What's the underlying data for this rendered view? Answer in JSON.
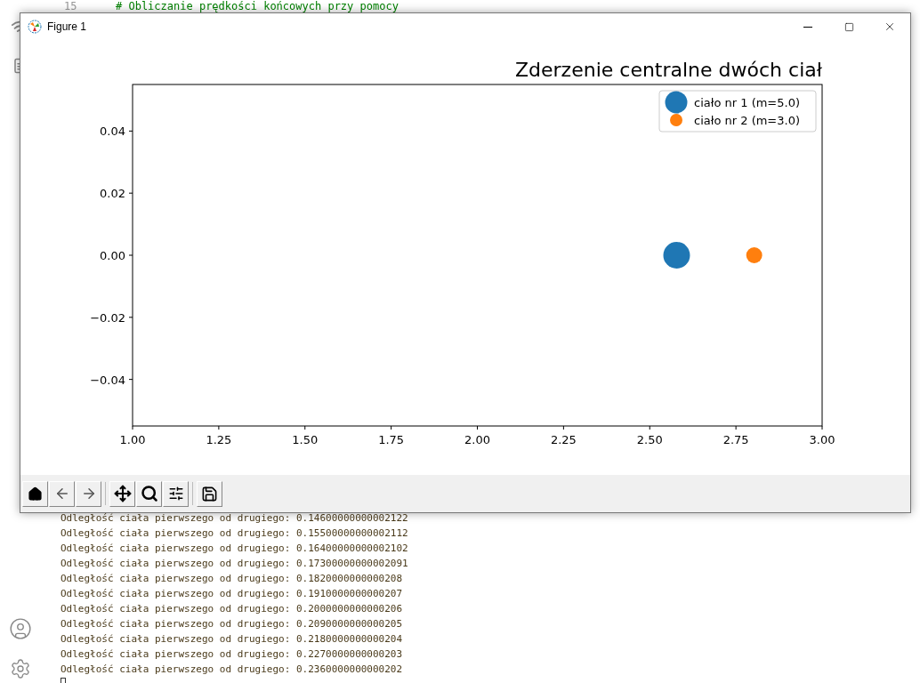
{
  "editor": {
    "line_number": "15",
    "code_line": "# Obliczanie prędkości końcowych przy pomocy"
  },
  "console": {
    "lines": [
      "Odległość ciała pierwszego od drugiego: 0.14600000000002122",
      "Odległość ciała pierwszego od drugiego: 0.15500000000002112",
      "Odległość ciała pierwszego od drugiego: 0.16400000000002102",
      "Odległość ciała pierwszego od drugiego: 0.17300000000002091",
      "Odległość ciała pierwszego od drugiego: 0.1820000000000208",
      "Odległość ciała pierwszego od drugiego: 0.1910000000000207",
      "Odległość ciała pierwszego od drugiego: 0.2000000000000206",
      "Odległość ciała pierwszego od drugiego: 0.2090000000000205",
      "Odległość ciała pierwszego od drugiego: 0.2180000000000204",
      "Odległość ciała pierwszego od drugiego: 0.2270000000000203",
      "Odległość ciała pierwszego od drugiego: 0.2360000000000202"
    ]
  },
  "window": {
    "title": "Figure 1",
    "chart_data": {
      "type": "scatter",
      "title": "Zderzenie centralne dwóch ciał",
      "legend": "upper right",
      "xlim": [
        1.0,
        3.0
      ],
      "ylim": [
        -0.055,
        0.055
      ],
      "xticks": [
        {
          "value": 1.0,
          "label": "1.00"
        },
        {
          "value": 1.25,
          "label": "1.25"
        },
        {
          "value": 1.5,
          "label": "1.50"
        },
        {
          "value": 1.75,
          "label": "1.75"
        },
        {
          "value": 2.0,
          "label": "2.00"
        },
        {
          "value": 2.25,
          "label": "2.25"
        },
        {
          "value": 2.5,
          "label": "2.50"
        },
        {
          "value": 2.75,
          "label": "2.75"
        },
        {
          "value": 3.0,
          "label": "3.00"
        }
      ],
      "yticks": [
        {
          "value": 0.04,
          "label": "0.04"
        },
        {
          "value": 0.02,
          "label": "0.02"
        },
        {
          "value": 0.0,
          "label": "0.00"
        },
        {
          "value": -0.02,
          "label": "−0.02"
        },
        {
          "value": -0.04,
          "label": "−0.04"
        }
      ],
      "series": [
        {
          "name": "ciało nr 1 (m=5.0)",
          "color": "#1f77b4",
          "x": [
            2.578
          ],
          "values": [
            0.0
          ]
        },
        {
          "name": "ciało nr 2 (m=3.0)",
          "color": "#ff7f0e",
          "x": [
            2.803
          ],
          "values": [
            0.0
          ]
        }
      ]
    }
  }
}
